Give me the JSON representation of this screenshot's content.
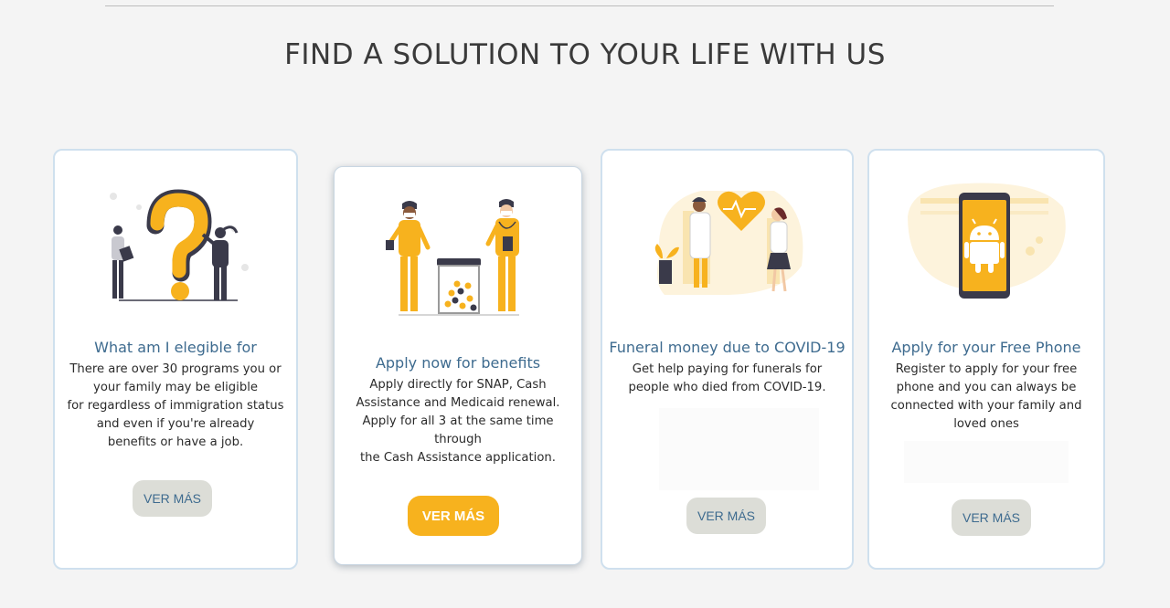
{
  "header": {
    "title": "FIND A SOLUTION TO YOUR LIFE WITH US"
  },
  "cards": [
    {
      "title": "What am I elegible for",
      "lines": [
        "There are over 30 programs you or",
        "your family may be eligible",
        "for regardless of immigration status",
        "and even if you're already",
        "benefits or have a job."
      ],
      "button": "VER MÁS",
      "illustration": "question-mark-people-illustration"
    },
    {
      "title": "Apply now for benefits",
      "lines": [
        "Apply directly for SNAP, Cash",
        "Assistance and Medicaid renewal.",
        "Apply for all 3 at the same time",
        "through",
        "the Cash Assistance application."
      ],
      "button": "VER MÁS",
      "illustration": "medical-staff-jar-illustration"
    },
    {
      "title": "Funeral money due to COVID-19",
      "lines": [
        "Get help paying for funerals for",
        "people who died from COVID-19."
      ],
      "button": "VER MÁS",
      "illustration": "doctors-heart-illustration"
    },
    {
      "title": "Apply for your Free Phone",
      "lines": [
        "Register to apply for your free",
        "phone and you can always be",
        "connected with your family and",
        "loved ones"
      ],
      "button": "VER MÁS",
      "illustration": "android-phone-illustration"
    }
  ],
  "colors": {
    "accent": "#f7b21e",
    "title_blue": "#3e6b8f",
    "button_grey": "#dcddd7"
  }
}
